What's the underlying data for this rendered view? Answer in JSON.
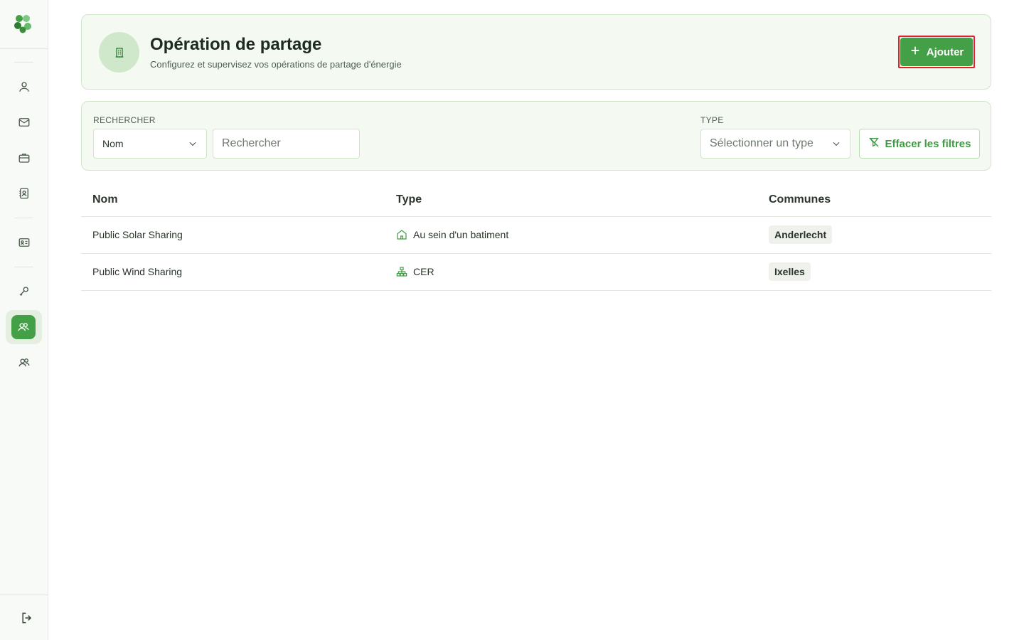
{
  "sidebar": {
    "items": [
      {
        "name": "user-icon"
      },
      {
        "name": "mail-icon"
      },
      {
        "name": "briefcase-icon"
      },
      {
        "name": "contact-book-icon"
      },
      {
        "name": "id-card-icon"
      },
      {
        "name": "key-icon"
      },
      {
        "name": "users-icon",
        "active": true
      },
      {
        "name": "users-alt-icon"
      }
    ],
    "logout_icon": "logout-icon"
  },
  "header": {
    "title": "Opération de partage",
    "subtitle": "Configurez et supervisez vos opérations de partage d'énergie",
    "add_label": "Ajouter"
  },
  "filters": {
    "search_label": "RECHERCHER",
    "search_field_value": "Nom",
    "search_placeholder": "Rechercher",
    "type_label": "TYPE",
    "type_placeholder": "Sélectionner un type",
    "clear_label": "Effacer les filtres"
  },
  "table": {
    "columns": [
      "Nom",
      "Type",
      "Communes"
    ],
    "rows": [
      {
        "name": "Public Solar Sharing",
        "type": "Au sein d'un batiment",
        "type_icon": "building-home-icon",
        "commune": "Anderlecht"
      },
      {
        "name": "Public Wind Sharing",
        "type": "CER",
        "type_icon": "network-icon",
        "commune": "Ixelles"
      }
    ]
  },
  "colors": {
    "accent": "#43a047",
    "card_bg": "#f4faf2",
    "card_border": "#cfe6cb",
    "highlight_outline": "#e0202a"
  }
}
